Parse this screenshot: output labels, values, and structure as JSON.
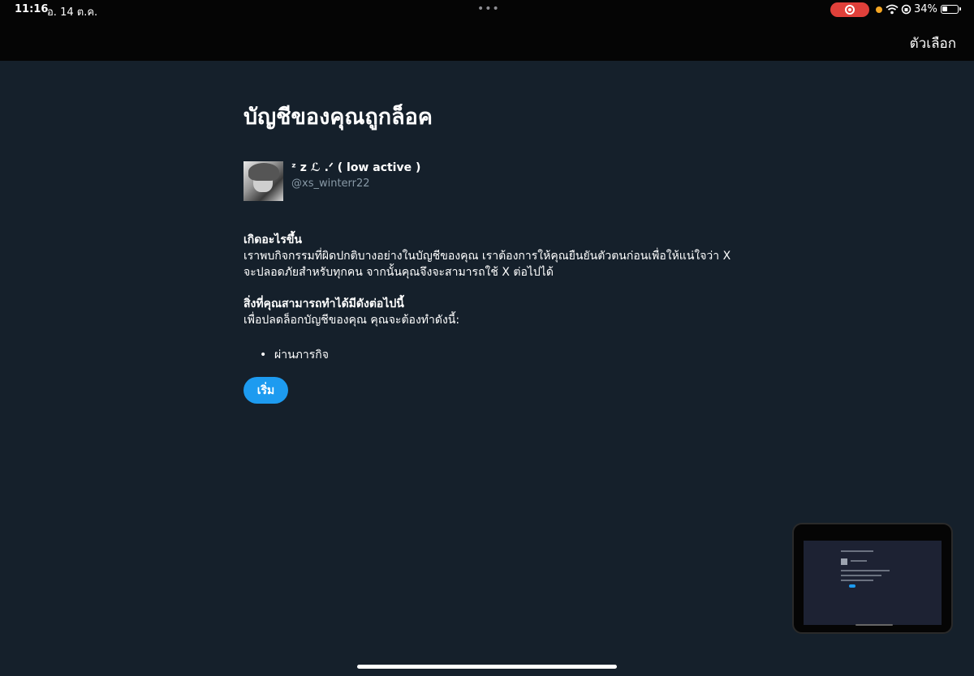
{
  "status_bar": {
    "time": "11:16",
    "date": "อ. 14 ต.ค.",
    "battery": "34%",
    "battery_level": 0.34,
    "record_color": "#e0403a",
    "indicator_color": "#f5a623"
  },
  "header": {
    "options_label": "ตัวเลือก"
  },
  "main": {
    "title": "บัญชีของคุณถูกล็อค",
    "account": {
      "display_name": "ᶻ z ℒ .ᐟ ( low active )",
      "handle": "@xs_winterr22"
    },
    "what_happened": {
      "heading": "เกิดอะไรขึ้น",
      "body": "เราพบกิจกรรมที่ผิดปกติบางอย่างในบัญชีของคุณ เราต้องการให้คุณยืนยันตัวตนก่อนเพื่อให้แน่ใจว่า X จะปลอดภัยสำหรับทุกคน จากนั้นคุณจึงจะสามารถใช้ X ต่อไปได้"
    },
    "what_you_can_do": {
      "heading": "สิ่งที่คุณสามารถทำได้มีดังต่อไปนี้",
      "body": "เพื่อปลดล็อกบัญชีของคุณ คุณจะต้องทำดังนี้:",
      "tasks": [
        "ผ่านภารกิจ"
      ]
    },
    "start_button": "เริ่ม",
    "button_color": "#1d9bf0"
  },
  "icons": {
    "wifi": "wifi-icon",
    "orientation_lock": "orientation-lock-icon",
    "battery": "battery-icon",
    "record": "screen-record-icon"
  }
}
